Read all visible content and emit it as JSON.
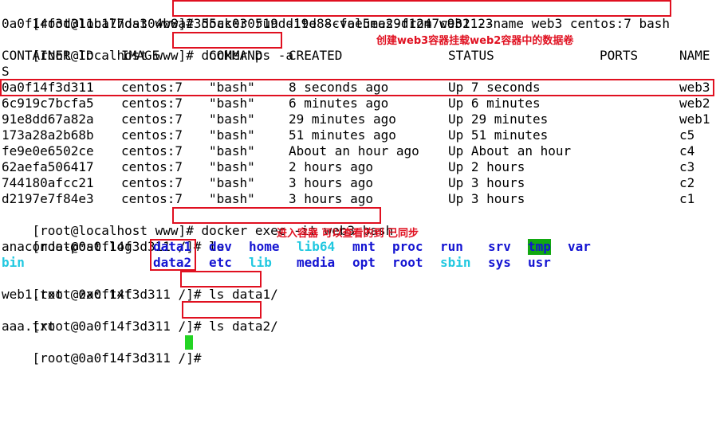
{
  "line1": {
    "prompt": "[root@localhost www]# ",
    "command": "docker run -itd --volumes-from web2 --name web3 centos:7 bash"
  },
  "line2": "0a0f14f3d311b177da304b8a2355ac030519dd19e88cfae5ea29d1247c931123",
  "line3": {
    "prompt": "[root@localhost www]# ",
    "command": "docker ps -a"
  },
  "ps_header": [
    "CONTAINER ID",
    "IMAGE",
    "COMMAND",
    "CREATED",
    "STATUS",
    "PORTS",
    "NAME"
  ],
  "ps_header_wrap": "S",
  "ps_rows": [
    [
      "0a0f14f3d311",
      "centos:7",
      "\"bash\"",
      "8 seconds ago",
      "Up 7 seconds",
      "web3"
    ],
    [
      "6c919c7bcfa5",
      "centos:7",
      "\"bash\"",
      "6 minutes ago",
      "Up 6 minutes",
      "web2"
    ],
    [
      "91e8dd67a82a",
      "centos:7",
      "\"bash\"",
      "29 minutes ago",
      "Up 29 minutes",
      "web1"
    ],
    [
      "173a28a2b68b",
      "centos:7",
      "\"bash\"",
      "51 minutes ago",
      "Up 51 minutes",
      "c5"
    ],
    [
      "fe9e0e6502ce",
      "centos:7",
      "\"bash\"",
      "About an hour ago",
      "Up About an hour",
      "c4"
    ],
    [
      "62aefa506417",
      "centos:7",
      "\"bash\"",
      "2 hours ago",
      "Up 2 hours",
      "c3"
    ],
    [
      "744180afcc21",
      "centos:7",
      "\"bash\"",
      "3 hours ago",
      "Up 3 hours",
      "c2"
    ],
    [
      "d2197e7f84e3",
      "centos:7",
      "\"bash\"",
      "3 hours ago",
      "Up 3 hours",
      "c1"
    ]
  ],
  "exec_line": {
    "prompt": "[root@localhost www]# ",
    "command": "docker exec -it web3 bash"
  },
  "ls_line": {
    "prompt": "[root@0a0f14f3d311 /]# ",
    "command": "ls"
  },
  "ls_row1": [
    "anaconda-post.log",
    "data1",
    "dev",
    "home",
    "lib64",
    "mnt",
    "proc",
    "run",
    "srv",
    "tmp",
    "var"
  ],
  "ls_row2": [
    "bin",
    "data2",
    "etc",
    "lib",
    "media",
    "opt",
    "root",
    "sbin",
    "sys",
    "usr"
  ],
  "ls_data1_line": {
    "prompt": "[root@0a0f14f3d311 /]# ",
    "command": "ls data1/"
  },
  "ls_data1_output": "web1.txt  zxc.txt",
  "ls_data2_line": {
    "prompt": "[root@0a0f14f3d311 /]# ",
    "command": "ls data2/"
  },
  "ls_data2_output": "aaa.txt",
  "last_prompt": "[root@0a0f14f3d311 /]# ",
  "annotations": {
    "create": "创建web3容器挂载web2容器中的数据卷",
    "enter": "进入容器 可以查看的到  已同步"
  },
  "colors": {
    "annotation": "#e01020",
    "directory": "#1414d2",
    "symlink": "#20c8e0",
    "tmp_bg": "#11a811",
    "cursor": "#23d423"
  }
}
